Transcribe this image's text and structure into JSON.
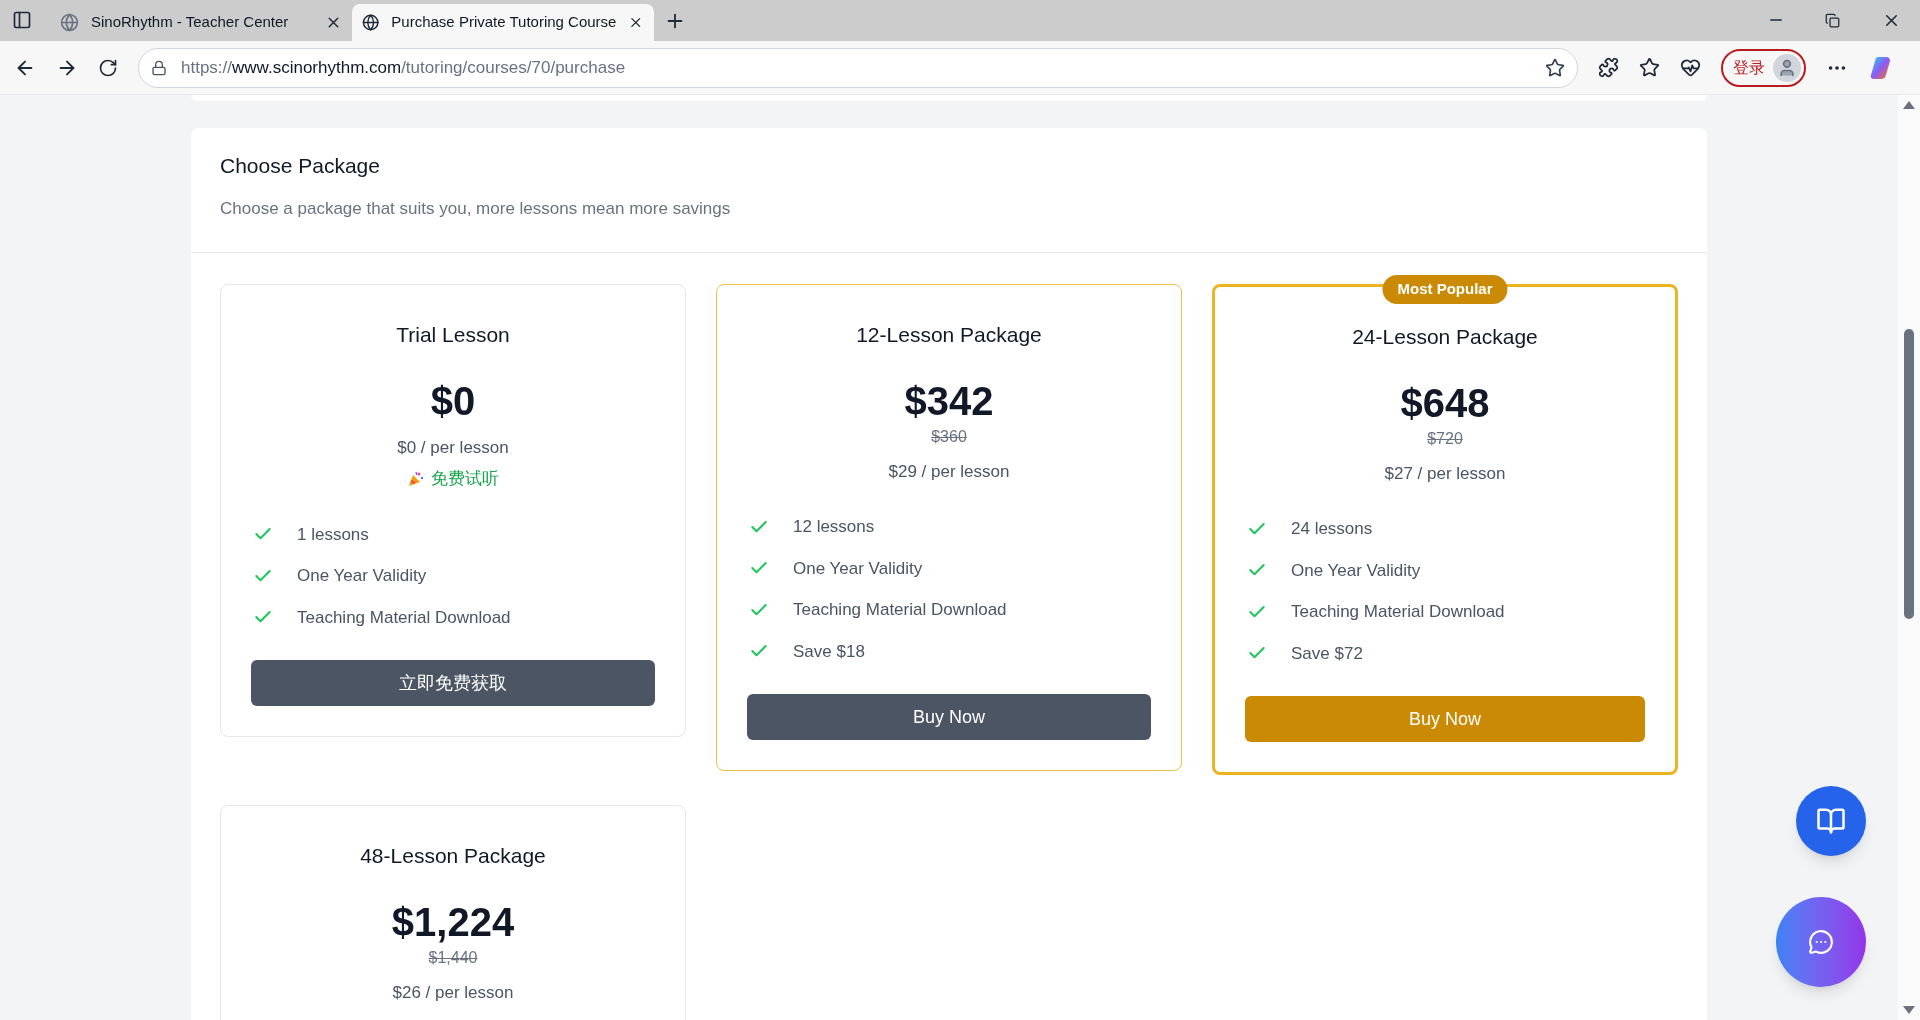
{
  "browser": {
    "tabs": [
      {
        "title": "SinoRhythm - Teacher Center",
        "selected": false
      },
      {
        "title": "Purchase Private Tutoring Course",
        "selected": true
      }
    ],
    "url": {
      "scheme": "https://",
      "host": "www.scinorhythm.com",
      "path": "/tutoring/courses/70/purchase"
    },
    "login_label": "登录"
  },
  "panel": {
    "heading": "Choose Package",
    "subtitle": "Choose a package that suits you, more lessons mean more savings"
  },
  "packages": [
    {
      "title": "Trial Lesson",
      "price": "$0",
      "per_lesson": "$0 / per lesson",
      "trial_note": "免费试听",
      "features": [
        "1 lessons",
        "One Year Validity",
        "Teaching Material Download"
      ],
      "button": {
        "label": "立即免费获取",
        "kind": "dark"
      },
      "kind": "plain"
    },
    {
      "title": "12-Lesson Package",
      "price": "$342",
      "original_price": "$360",
      "per_lesson": "$29 / per lesson",
      "features": [
        "12 lessons",
        "One Year Validity",
        "Teaching Material Download",
        "Save $18"
      ],
      "button": {
        "label": "Buy Now",
        "kind": "dark"
      },
      "kind": "featured"
    },
    {
      "title": "24-Lesson Package",
      "badge": "Most Popular",
      "price": "$648",
      "original_price": "$720",
      "per_lesson": "$27 / per lesson",
      "features": [
        "24 lessons",
        "One Year Validity",
        "Teaching Material Download",
        "Save $72"
      ],
      "button": {
        "label": "Buy Now",
        "kind": "gold"
      },
      "kind": "popular"
    },
    {
      "title": "48-Lesson Package",
      "price": "$1,224",
      "original_price": "$1,440",
      "per_lesson": "$26 / per lesson",
      "kind": "plain"
    }
  ]
}
